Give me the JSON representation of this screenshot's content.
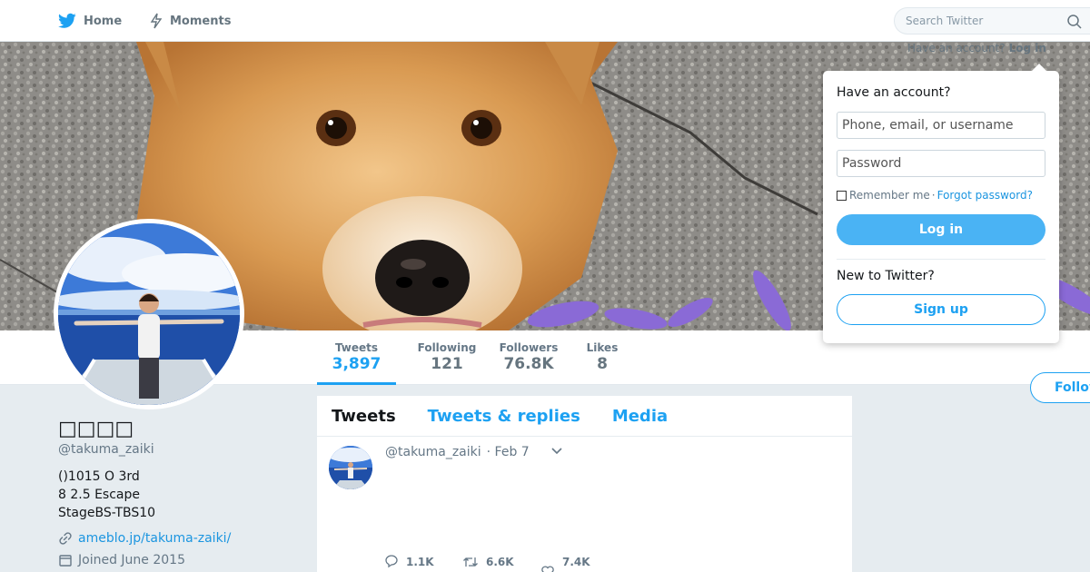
{
  "nav": {
    "home_label": "Home",
    "moments_label": "Moments",
    "search_placeholder": "Search Twitter",
    "have_account_text": "Have an account?",
    "login_link": "Log in"
  },
  "profile": {
    "name": "□□□□",
    "handle": "@takuma_zaiki",
    "bio": "()1015  O  3rd\n 8 2.5 Escape\nStageBS-TBS10",
    "link": "ameblo.jp/takuma-zaiki/",
    "joined": "Joined June 2015"
  },
  "stats": [
    {
      "label": "Tweets",
      "value": "3,897",
      "active": true
    },
    {
      "label": "Following",
      "value": "121"
    },
    {
      "label": "Followers",
      "value": "76.8K"
    },
    {
      "label": "Likes",
      "value": "8"
    }
  ],
  "follow_label": "Follow",
  "timeline": {
    "tabs": [
      "Tweets",
      "Tweets & replies",
      "Media"
    ],
    "tweet": {
      "handle": "@takuma_zaiki",
      "date": "· Feb 7",
      "replies": "1.1K",
      "retweets": "6.6K",
      "likes": "7.4K"
    }
  },
  "login_dropdown": {
    "title": "Have an account?",
    "username_placeholder": "Phone, email, or username",
    "password_placeholder": "Password",
    "remember_label": "Remember me",
    "separator": "·",
    "forgot_label": "Forgot password?",
    "login_button": "Log in",
    "new_text": "New to Twitter?",
    "signup_button": "Sign up"
  },
  "colors": {
    "accent": "#1da1f2",
    "login_button": "#4ab3f4",
    "background": "#e6ecf0"
  }
}
